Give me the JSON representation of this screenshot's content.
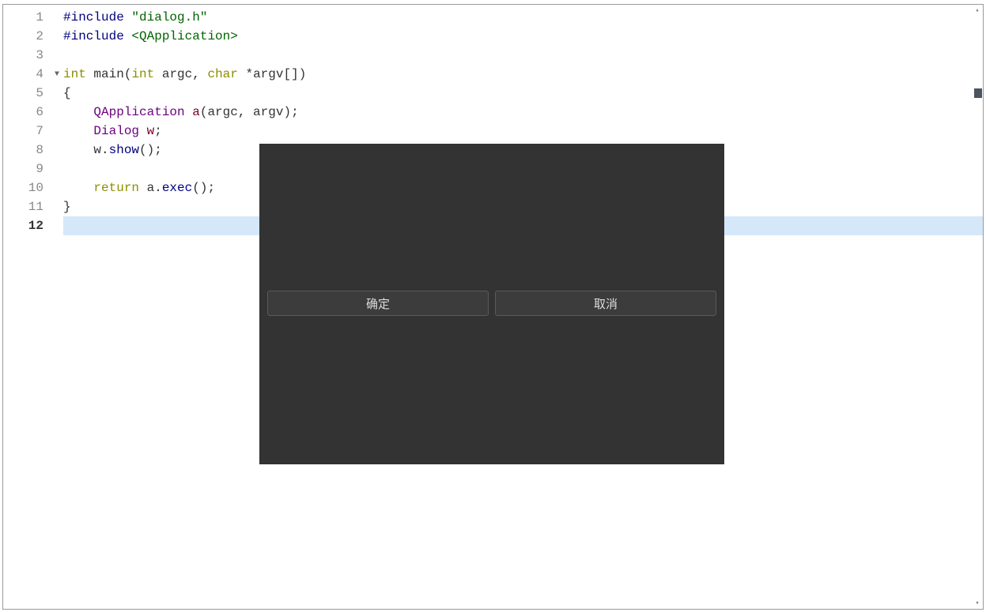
{
  "editor": {
    "lines": [
      {
        "num": "1",
        "tokens": [
          {
            "t": "#include ",
            "c": "hl-include"
          },
          {
            "t": "\"dialog.h\"",
            "c": "hl-string"
          }
        ]
      },
      {
        "num": "2",
        "tokens": [
          {
            "t": "#include ",
            "c": "hl-include"
          },
          {
            "t": "<QApplication>",
            "c": "hl-include-bracket"
          }
        ]
      },
      {
        "num": "3",
        "tokens": []
      },
      {
        "num": "4",
        "fold": true,
        "tokens": [
          {
            "t": "int",
            "c": "hl-keyword"
          },
          {
            "t": " ",
            "c": ""
          },
          {
            "t": "main",
            "c": ""
          },
          {
            "t": "(",
            "c": ""
          },
          {
            "t": "int",
            "c": "hl-keyword"
          },
          {
            "t": " argc, ",
            "c": ""
          },
          {
            "t": "char",
            "c": "hl-keyword"
          },
          {
            "t": " *argv[])",
            "c": ""
          }
        ]
      },
      {
        "num": "5",
        "tokens": [
          {
            "t": "{",
            "c": ""
          }
        ]
      },
      {
        "num": "6",
        "tokens": [
          {
            "t": "    ",
            "c": ""
          },
          {
            "t": "QApplication",
            "c": "hl-class"
          },
          {
            "t": " ",
            "c": ""
          },
          {
            "t": "a",
            "c": "hl-identifier"
          },
          {
            "t": "(argc, argv);",
            "c": ""
          }
        ]
      },
      {
        "num": "7",
        "tokens": [
          {
            "t": "    ",
            "c": ""
          },
          {
            "t": "Dialog",
            "c": "hl-class"
          },
          {
            "t": " ",
            "c": ""
          },
          {
            "t": "w",
            "c": "hl-identifier"
          },
          {
            "t": ";",
            "c": ""
          }
        ]
      },
      {
        "num": "8",
        "tokens": [
          {
            "t": "    w.",
            "c": ""
          },
          {
            "t": "show",
            "c": "hl-method"
          },
          {
            "t": "();",
            "c": ""
          }
        ]
      },
      {
        "num": "9",
        "tokens": []
      },
      {
        "num": "10",
        "tokens": [
          {
            "t": "    ",
            "c": ""
          },
          {
            "t": "return",
            "c": "hl-keyword"
          },
          {
            "t": " a.",
            "c": ""
          },
          {
            "t": "exec",
            "c": "hl-method"
          },
          {
            "t": "();",
            "c": ""
          }
        ]
      },
      {
        "num": "11",
        "tokens": [
          {
            "t": "}",
            "c": ""
          }
        ]
      },
      {
        "num": "12",
        "current": true,
        "tokens": []
      }
    ],
    "current_line": 12
  },
  "dialog": {
    "ok_label": "确定",
    "cancel_label": "取消"
  }
}
